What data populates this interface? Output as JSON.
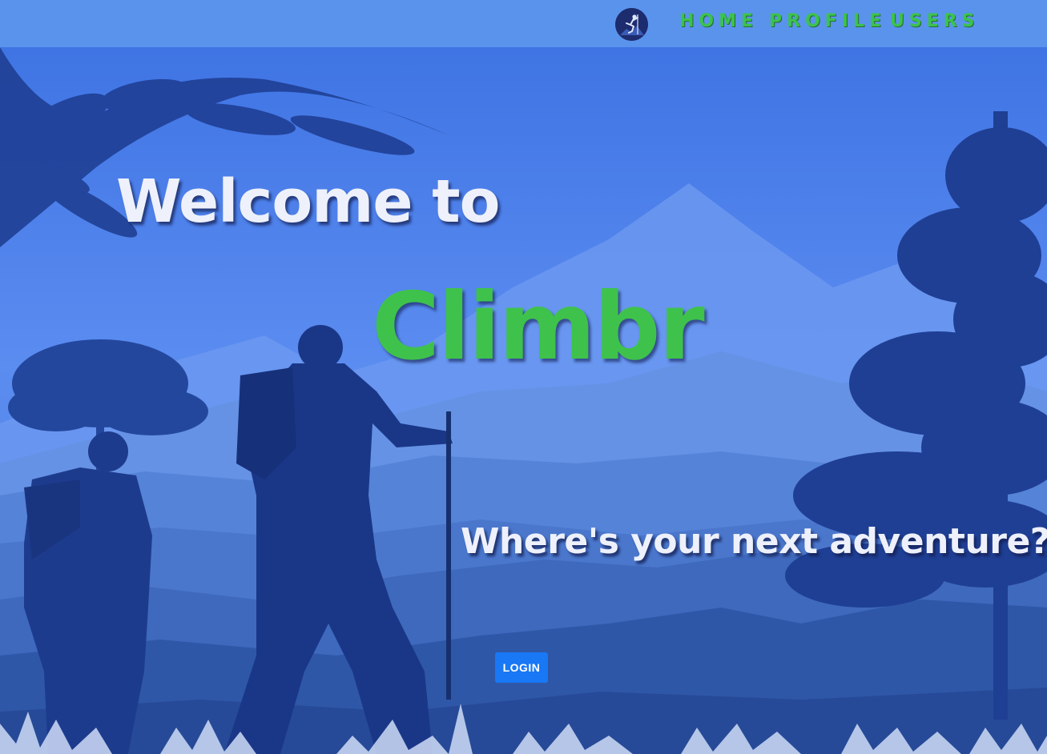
{
  "navbar": {
    "logo_icon": "climber-logo-icon",
    "links": [
      {
        "label": "HOME"
      },
      {
        "label": "PROFILE"
      },
      {
        "label": "USERS"
      }
    ]
  },
  "hero": {
    "welcome": "Welcome to",
    "brand": "Climbr",
    "tagline": "Where's your next adventure?",
    "login_label": "LOGIN"
  },
  "colors": {
    "navbar_bg": "#5a93ec",
    "nav_link": "#3cc24f",
    "brand": "#3ec24c",
    "login_button": "#1878f5",
    "hero_text": "#eef1fb"
  }
}
